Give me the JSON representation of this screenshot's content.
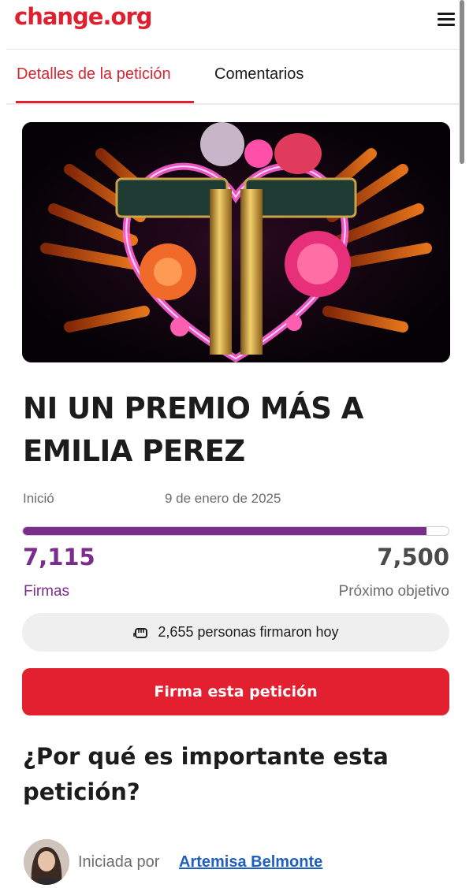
{
  "header": {
    "logo": "change.org",
    "menu_icon": "hamburger-menu-icon"
  },
  "tabs": [
    {
      "label": "Detalles de la petición",
      "active": true
    },
    {
      "label": "Comentarios",
      "active": false
    }
  ],
  "petition": {
    "title": "NI UN PREMIO MÁS A EMILIA PEREZ",
    "started_label": "Inició",
    "started_date": "9 de enero de 2025",
    "signatures": "7,115",
    "signatures_label": "Firmas",
    "goal": "7,500",
    "goal_label": "Próximo objetivo",
    "progress_fraction": 0.9487,
    "signed_today": "2,655 personas firmaron hoy",
    "signed_today_icon": "fist-icon",
    "sign_button": "Firma esta petición"
  },
  "why_section": {
    "heading": "¿Por qué es importante esta petición?",
    "started_by": "Iniciada por",
    "author": "Artemisa Belmonte"
  },
  "colors": {
    "brand_red": "#e0202e",
    "progress_purple": "#7b2d8e",
    "link_blue": "#1f5fbf"
  }
}
